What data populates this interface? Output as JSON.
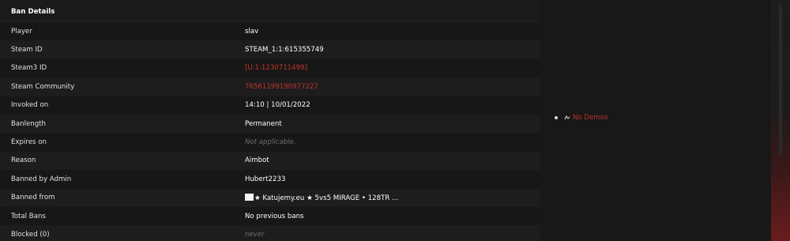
{
  "section_title": "Ban Details",
  "rows": [
    {
      "label": "Player",
      "value": "slav"
    },
    {
      "label": "Steam ID",
      "value": "STEAM_1:1:615355749"
    },
    {
      "label": "Steam3 ID",
      "value": "[U:1:1230711499]"
    },
    {
      "label": "Steam Community",
      "value": "76561199190977227"
    },
    {
      "label": "Invoked on",
      "value": "14:10 | 10/01/2022"
    },
    {
      "label": "Banlength",
      "value": "Permanent"
    },
    {
      "label": "Expires on",
      "value": "Not applicable."
    },
    {
      "label": "Reason",
      "value": "Aimbot"
    },
    {
      "label": "Banned by Admin",
      "value": "Hubert2233"
    },
    {
      "label": "Banned from",
      "value": "★ Katujemy.eu ★ 5vs5 MIRAGE • 128TR ..."
    },
    {
      "label": "Total Bans",
      "value": "No previous bans"
    },
    {
      "label": "Blocked (0)",
      "value": "never"
    }
  ],
  "demos": {
    "icon": "film-icon",
    "label": "No Demos"
  },
  "colors": {
    "link": "#c0342b",
    "background": "#171717",
    "muted": "#6d6d6d"
  }
}
